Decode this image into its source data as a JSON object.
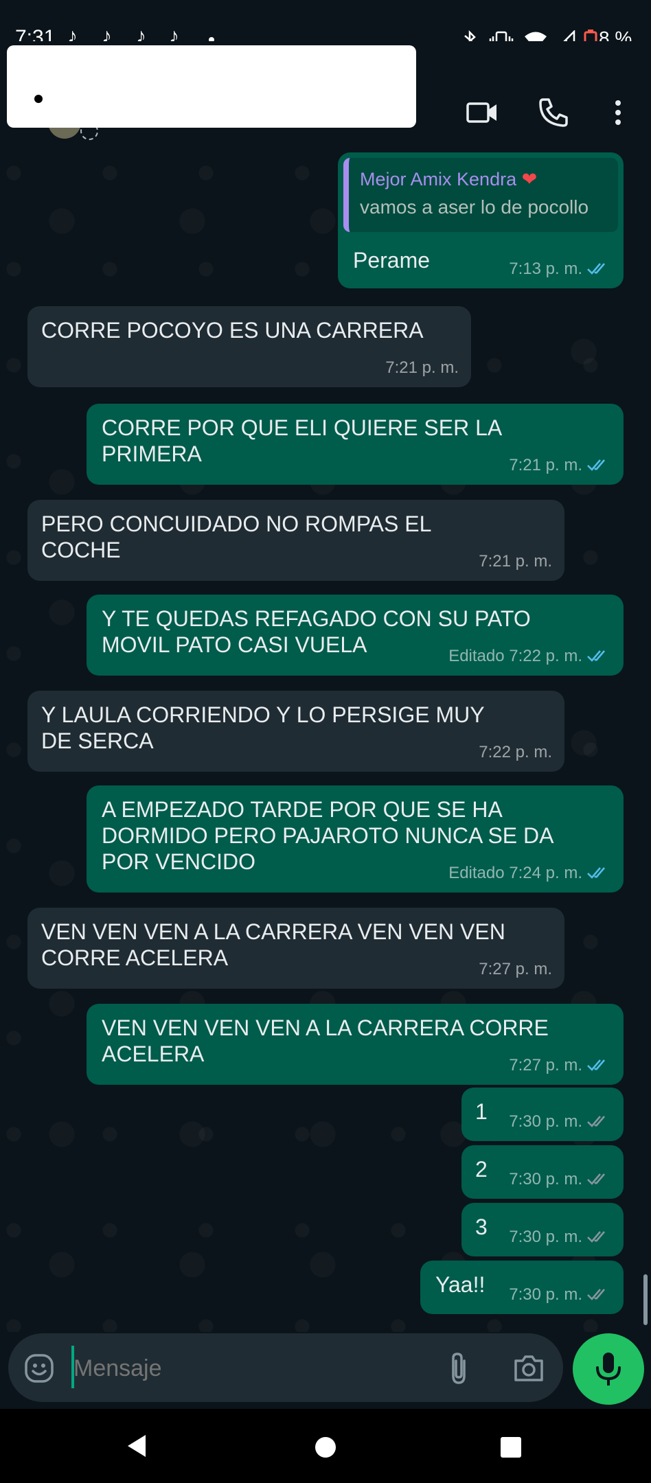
{
  "status_bar": {
    "time": "7:31",
    "battery": "8 %",
    "tiktok_glyph": "♪"
  },
  "input": {
    "placeholder": "Mensaje"
  },
  "quote": {
    "author": "Mejor Amix Kendra",
    "text": "vamos a aser lo de pocollo"
  },
  "messages": [
    {
      "dir": "out",
      "lines": [
        "Perame"
      ],
      "time": "7:13 p. m.",
      "read": true
    },
    {
      "dir": "in",
      "lines": [
        "CORRE POCOYO ES UNA CARRERA"
      ],
      "time": "7:21 p. m."
    },
    {
      "dir": "out",
      "lines": [
        "CORRE POR QUE ELI QUIERE SER LA",
        "PRIMERA"
      ],
      "time": "7:21 p. m.",
      "read": true
    },
    {
      "dir": "in",
      "lines": [
        "PERO CONCUIDADO NO ROMPAS EL",
        "COCHE"
      ],
      "time": "7:21 p. m."
    },
    {
      "dir": "out",
      "lines": [
        "Y TE QUEDAS REFAGADO CON SU PATO",
        "MOVIL PATO CASI VUELA"
      ],
      "time": "Editado 7:22 p. m.",
      "read": true
    },
    {
      "dir": "in",
      "lines": [
        "Y LAULA CORRIENDO Y LO PERSIGE MUY",
        "DE SERCA"
      ],
      "time": "7:22 p. m."
    },
    {
      "dir": "out",
      "lines": [
        "A EMPEZADO TARDE POR QUE SE HA",
        "DORMIDO PERO PAJAROTO NUNCA SE DA",
        "POR VENCIDO"
      ],
      "time": "Editado 7:24 p. m.",
      "read": true
    },
    {
      "dir": "in",
      "lines": [
        "VEN VEN VEN A LA CARRERA VEN VEN VEN",
        "CORRE ACELERA"
      ],
      "time": "7:27 p. m."
    },
    {
      "dir": "out",
      "lines": [
        "VEN VEN VEN VEN A LA CARRERA CORRE",
        "ACELERA"
      ],
      "time": "7:27 p. m.",
      "read": true
    },
    {
      "dir": "out",
      "lines": [
        "1"
      ],
      "time": "7:30 p. m.",
      "read": false
    },
    {
      "dir": "out",
      "lines": [
        "2"
      ],
      "time": "7:30 p. m.",
      "read": false
    },
    {
      "dir": "out",
      "lines": [
        "3"
      ],
      "time": "7:30 p. m.",
      "read": false
    },
    {
      "dir": "out",
      "lines": [
        "Yaa!!"
      ],
      "time": "7:30 p. m.",
      "read": false
    }
  ],
  "colors": {
    "read_tick": "#53bdeb",
    "delivered_tick": "#8696a0",
    "outgoing_bubble": "#005c4b",
    "incoming_bubble": "#202c33",
    "accent": "#21c063"
  },
  "icons": [
    "video-call-icon",
    "phone-icon",
    "more-vert-icon",
    "emoji-icon",
    "attach-icon",
    "camera-icon",
    "mic-icon",
    "back-nav-icon",
    "home-nav-icon",
    "recents-nav-icon",
    "bluetooth-icon",
    "vibrate-icon",
    "wifi-icon",
    "signal-icon",
    "battery-icon",
    "heart-icon"
  ]
}
